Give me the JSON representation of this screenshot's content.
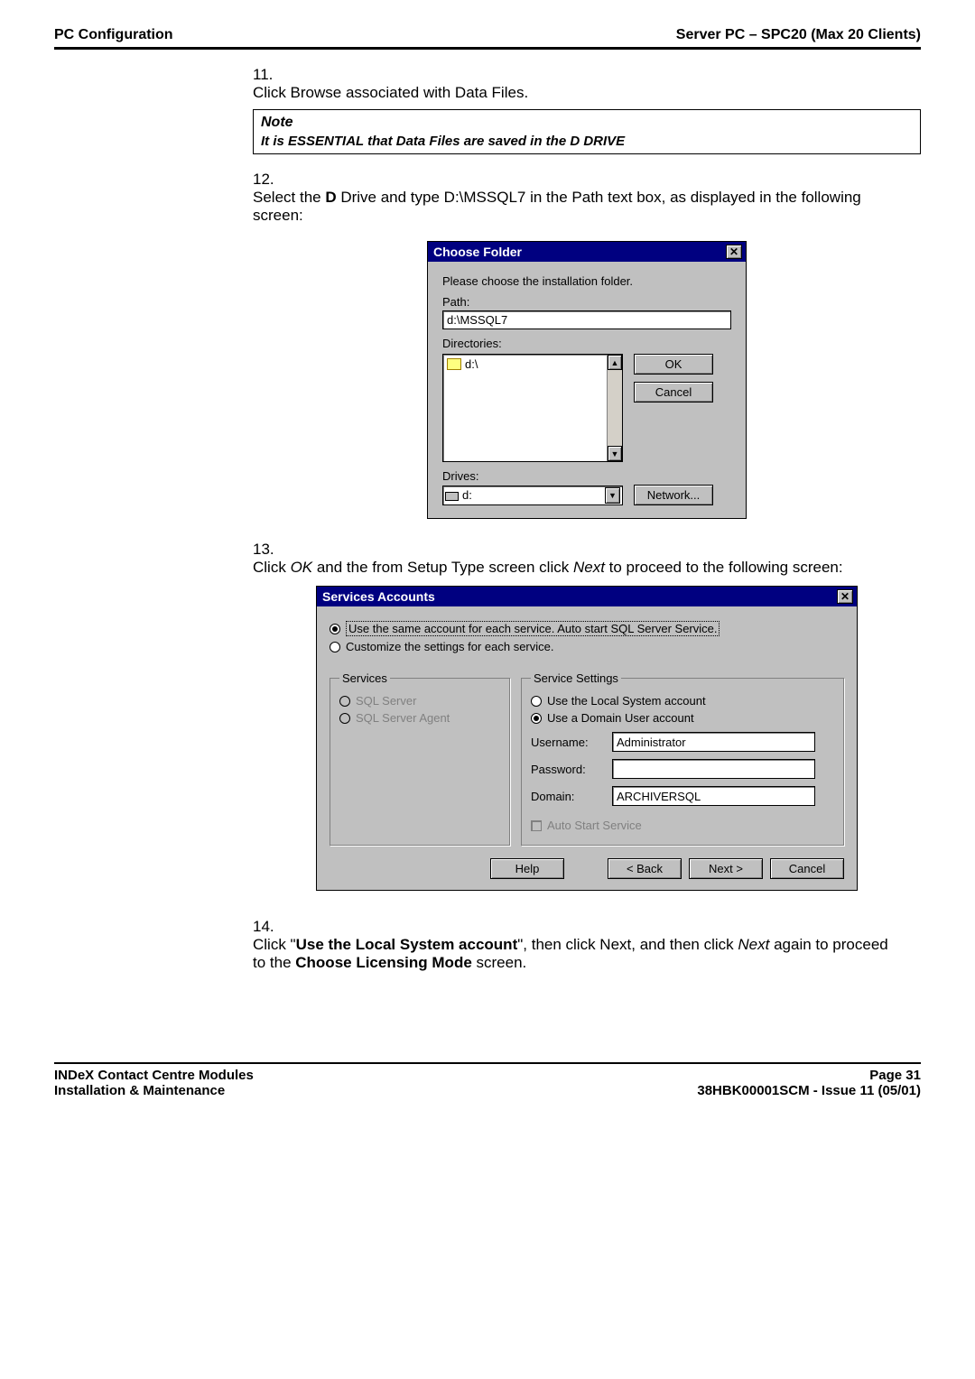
{
  "header": {
    "left": "PC Configuration",
    "right": "Server PC – SPC20 (Max 20 Clients)"
  },
  "steps": {
    "s11": {
      "num": "11.",
      "text": "Click Browse associated with Data Files."
    },
    "note": {
      "title": "Note",
      "body": "It is ESSENTIAL that Data Files are saved in the D DRIVE"
    },
    "s12": {
      "num": "12.",
      "pre": "Select the ",
      "bold1": "D",
      "mid": " Drive and type D:\\MSSQL7 in the Path text box, as displayed in the following screen:"
    },
    "s13": {
      "num": "13.",
      "pre": "Click ",
      "it1": "OK",
      "mid": " and the from Setup Type screen click ",
      "it2": "Next",
      "post": " to proceed to the following screen:"
    },
    "s14": {
      "num": "14.",
      "pre": "Click \"",
      "bold1": "Use the Local System account",
      "mid1": "\", then click Next, and then click ",
      "it1": "Next",
      "mid2": " again to proceed to the ",
      "bold2": "Choose Licensing Mode",
      "post": " screen."
    }
  },
  "chooseFolder": {
    "title": "Choose Folder",
    "instruction": "Please choose the installation folder.",
    "pathLabel": "Path:",
    "pathValue": "d:\\MSSQL7",
    "dirLabel": "Directories:",
    "dirItem": "d:\\",
    "drivesLabel": "Drives:",
    "driveValue": "d:",
    "ok": "OK",
    "cancel": "Cancel",
    "network": "Network..."
  },
  "servicesAccounts": {
    "title": "Services Accounts",
    "opt1": "Use the same account for each service. Auto start SQL Server Service.",
    "opt2": "Customize the settings for each service.",
    "servicesLegend": "Services",
    "svc1": "SQL Server",
    "svc2": "SQL Server Agent",
    "settingsLegend": "Service Settings",
    "localOpt": "Use the Local System account",
    "domainOpt": "Use a Domain User account",
    "userLabel": "Username:",
    "userValue": "Administrator",
    "passLabel": "Password:",
    "domainLabel": "Domain:",
    "domainValue": "ARCHIVERSQL",
    "autoStart": "Auto Start Service",
    "help": "Help",
    "back": "< Back",
    "next": "Next >",
    "cancel": "Cancel"
  },
  "footer": {
    "l1": "INDeX Contact Centre Modules",
    "l2": "Installation & Maintenance",
    "r1": "Page 31",
    "r2": "38HBK00001SCM - Issue 11 (05/01)"
  }
}
